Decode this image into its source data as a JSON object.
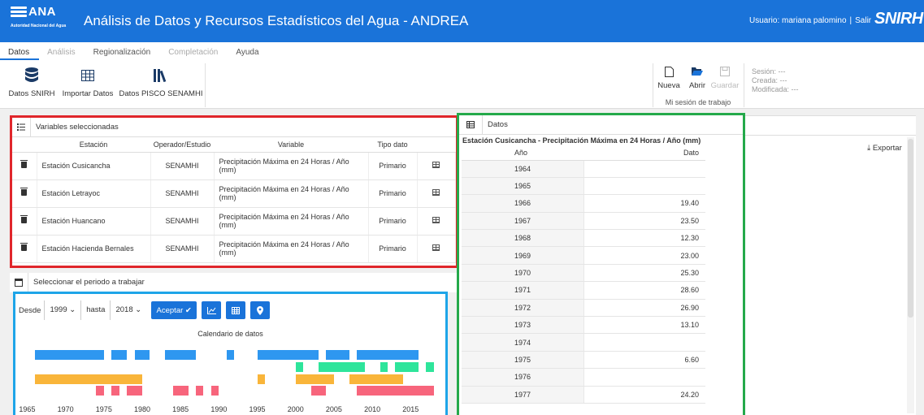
{
  "app": {
    "logo_name": "ANA",
    "logo_subtitle": "Autoridad Nacional del Agua",
    "title": "Análisis de Datos y Recursos Estadísticos del Agua - ANDREA",
    "user_label": "Usuario: mariana palomino",
    "logout": "Salir",
    "brand_right": "SNIRH"
  },
  "menu": {
    "tabs": [
      {
        "label": "Datos",
        "state": "active"
      },
      {
        "label": "Análisis",
        "state": "disabled"
      },
      {
        "label": "Regionalización",
        "state": "enabled"
      },
      {
        "label": "Completación",
        "state": "disabled"
      },
      {
        "label": "Ayuda",
        "state": "enabled"
      }
    ]
  },
  "ribbon": {
    "datos_snirh": "Datos SNIRH",
    "importar": "Importar Datos",
    "pisco": "Datos PISCO SENAMHI",
    "nueva": "Nueva",
    "abrir": "Abrir",
    "guardar": "Guardar",
    "session_group": "Mi sesión de trabajo",
    "sesion": "Sesión: ---",
    "creada": "Creada: ---",
    "modificada": "Modificada: ---"
  },
  "variables": {
    "title": "Variables seleccionadas",
    "headers": [
      "Estación",
      "Operador/Estudio",
      "Variable",
      "Tipo dato"
    ],
    "rows": [
      {
        "estacion": "Estación Cusicancha",
        "operador": "SENAMHI",
        "variable": "Precipitación Máxima en 24 Horas / Año (mm)",
        "tipo": "Primario"
      },
      {
        "estacion": "Estación Letrayoc",
        "operador": "SENAMHI",
        "variable": "Precipitación Máxima en 24 Horas / Año (mm)",
        "tipo": "Primario"
      },
      {
        "estacion": "Estación Huancano",
        "operador": "SENAMHI",
        "variable": "Precipitación Máxima en 24 Horas / Año (mm)",
        "tipo": "Primario"
      },
      {
        "estacion": "Estación Hacienda Bernales",
        "operador": "SENAMHI",
        "variable": "Precipitación Máxima en 24 Horas / Año (mm)",
        "tipo": "Primario"
      }
    ]
  },
  "period": {
    "title": "Seleccionar el periodo a trabajar",
    "desde_label": "Desde",
    "desde_value": "1999",
    "hasta_label": "hasta",
    "hasta_value": "2018",
    "accept": "Aceptar",
    "calendar_title": "Calendario de datos"
  },
  "chart_data": {
    "type": "timeline",
    "title": "Calendario de datos",
    "xlim": [
      1964,
      2019
    ],
    "xticks": [
      1965,
      1970,
      1975,
      1980,
      1985,
      1990,
      1995,
      2000,
      2005,
      2010,
      2015
    ],
    "series": [
      {
        "color": "#2e97f0",
        "ranges": [
          [
            1966,
            1975
          ],
          [
            1976,
            1978
          ],
          [
            1979,
            1981
          ],
          [
            1983,
            1987
          ],
          [
            1991,
            1992
          ],
          [
            1995,
            2003
          ],
          [
            2004,
            2007
          ],
          [
            2008,
            2016
          ]
        ]
      },
      {
        "color": "#2ee59b",
        "ranges": [
          [
            2000,
            2001
          ],
          [
            2003,
            2009
          ],
          [
            2011,
            2012
          ],
          [
            2013,
            2016
          ],
          [
            2017,
            2018
          ]
        ]
      },
      {
        "color": "#f9b53a",
        "ranges": [
          [
            1966,
            1980
          ],
          [
            1995,
            1996
          ],
          [
            2000,
            2005
          ],
          [
            2007,
            2014
          ]
        ]
      },
      {
        "color": "#f7657c",
        "ranges": [
          [
            1974,
            1975
          ],
          [
            1976,
            1977
          ],
          [
            1978,
            1980
          ],
          [
            1984,
            1986
          ],
          [
            1987,
            1988
          ],
          [
            1989,
            1990
          ],
          [
            2002,
            2004
          ],
          [
            2008,
            2018
          ]
        ]
      }
    ]
  },
  "datos": {
    "title": "Datos",
    "subtitle": "Estación Cusicancha - Precipitación Máxima en 24 Horas / Año (mm)",
    "col_year": "Año",
    "col_value": "Dato",
    "export": "Exportar",
    "rows": [
      {
        "y": "1964",
        "v": ""
      },
      {
        "y": "1965",
        "v": ""
      },
      {
        "y": "1966",
        "v": "19.40"
      },
      {
        "y": "1967",
        "v": "23.50"
      },
      {
        "y": "1968",
        "v": "12.30"
      },
      {
        "y": "1969",
        "v": "23.00"
      },
      {
        "y": "1970",
        "v": "25.30"
      },
      {
        "y": "1971",
        "v": "28.60"
      },
      {
        "y": "1972",
        "v": "26.90"
      },
      {
        "y": "1973",
        "v": "13.10"
      },
      {
        "y": "1974",
        "v": ""
      },
      {
        "y": "1975",
        "v": "6.60"
      },
      {
        "y": "1976",
        "v": ""
      },
      {
        "y": "1977",
        "v": "24.20"
      }
    ]
  },
  "colors": {
    "brand": "#1a73d9",
    "highlight_red": "#e0262b",
    "highlight_green": "#24a94a",
    "highlight_blue": "#1ea5e8"
  }
}
